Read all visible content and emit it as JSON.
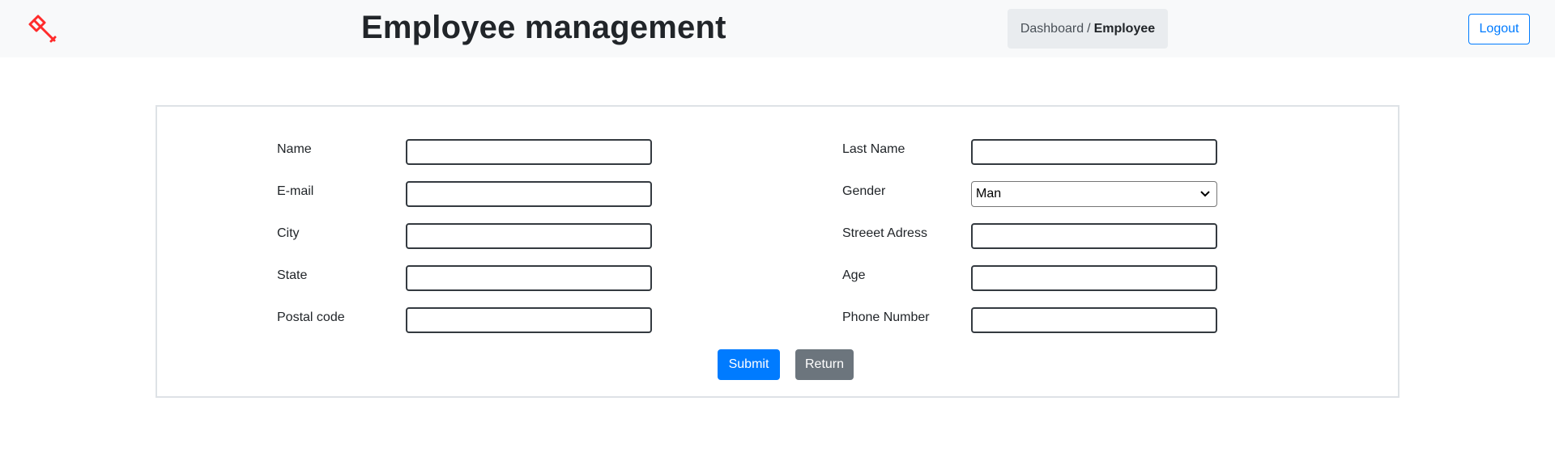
{
  "header": {
    "title": "Employee management",
    "logo_icon": "gavel-icon",
    "logo_color": "#ff2b2b",
    "breadcrumb": {
      "parent": "Dashboard",
      "separator": "/",
      "current": "Employee"
    },
    "logout_label": "Logout"
  },
  "form": {
    "left_fields": [
      {
        "label": "Name",
        "value": ""
      },
      {
        "label": "E-mail",
        "value": ""
      },
      {
        "label": "City",
        "value": ""
      },
      {
        "label": "State",
        "value": ""
      },
      {
        "label": "Postal code",
        "value": ""
      }
    ],
    "right_fields": [
      {
        "label": "Last Name",
        "value": ""
      },
      {
        "label": "Gender",
        "value": "Man"
      },
      {
        "label": "Streeet Adress",
        "value": ""
      },
      {
        "label": "Age",
        "value": ""
      },
      {
        "label": "Phone Number",
        "value": ""
      }
    ],
    "submit_label": "Submit",
    "return_label": "Return"
  },
  "colors": {
    "primary": "#007bff",
    "secondary": "#6c757d",
    "navbar_bg": "#f8f9fa"
  }
}
